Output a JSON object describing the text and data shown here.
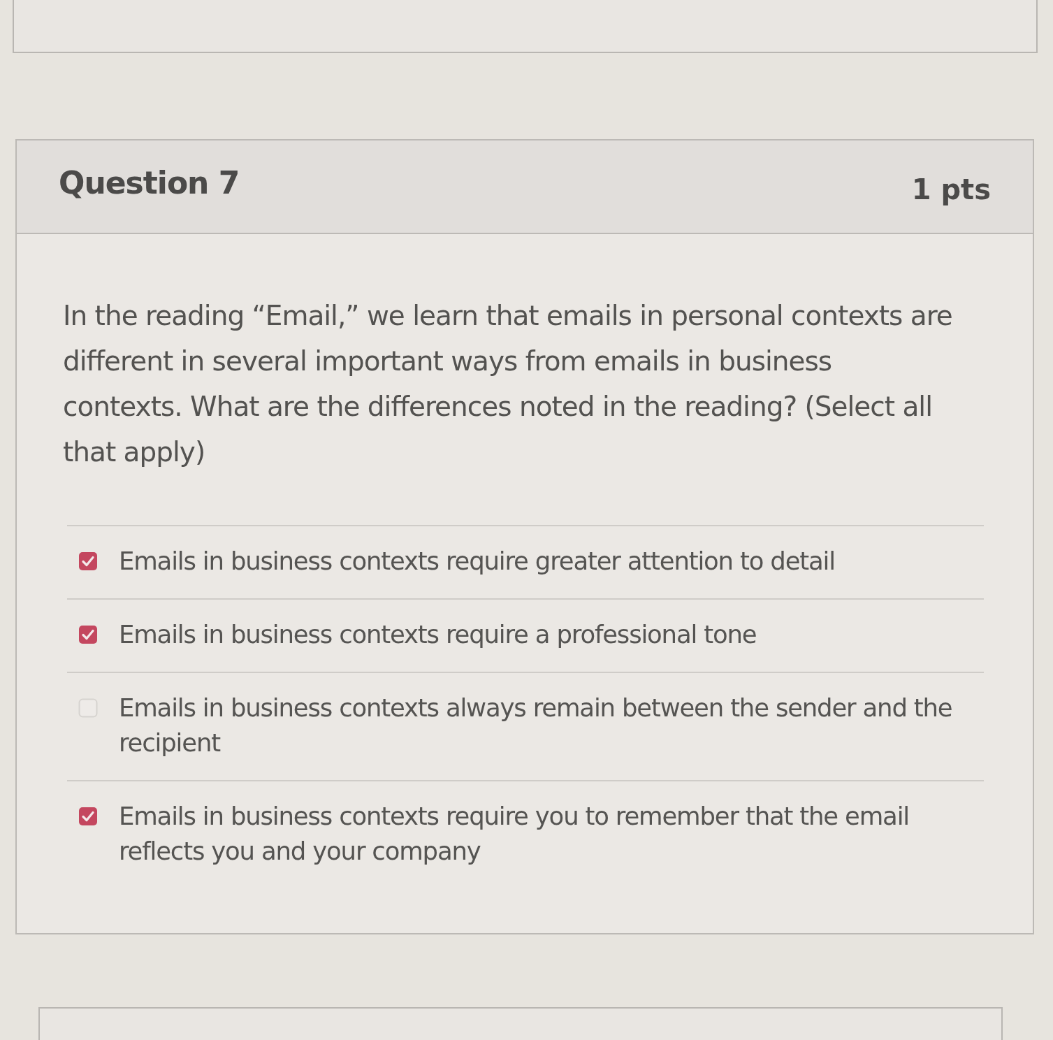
{
  "question": {
    "title": "Question 7",
    "points": "1 pts",
    "text": "In the reading “Email,” we learn that emails in personal contexts are different in several important ways from emails in business contexts. What are the differences noted in the reading? (Select all that apply)",
    "answers": [
      {
        "label": "Emails in business contexts require greater attention to detail",
        "checked": true
      },
      {
        "label": "Emails in business contexts require a professional tone",
        "checked": true
      },
      {
        "label": "Emails in business contexts always remain between the sender and the recipient",
        "checked": false
      },
      {
        "label": "Emails in business contexts require you to remember that the email reflects you and your company",
        "checked": true
      }
    ]
  }
}
